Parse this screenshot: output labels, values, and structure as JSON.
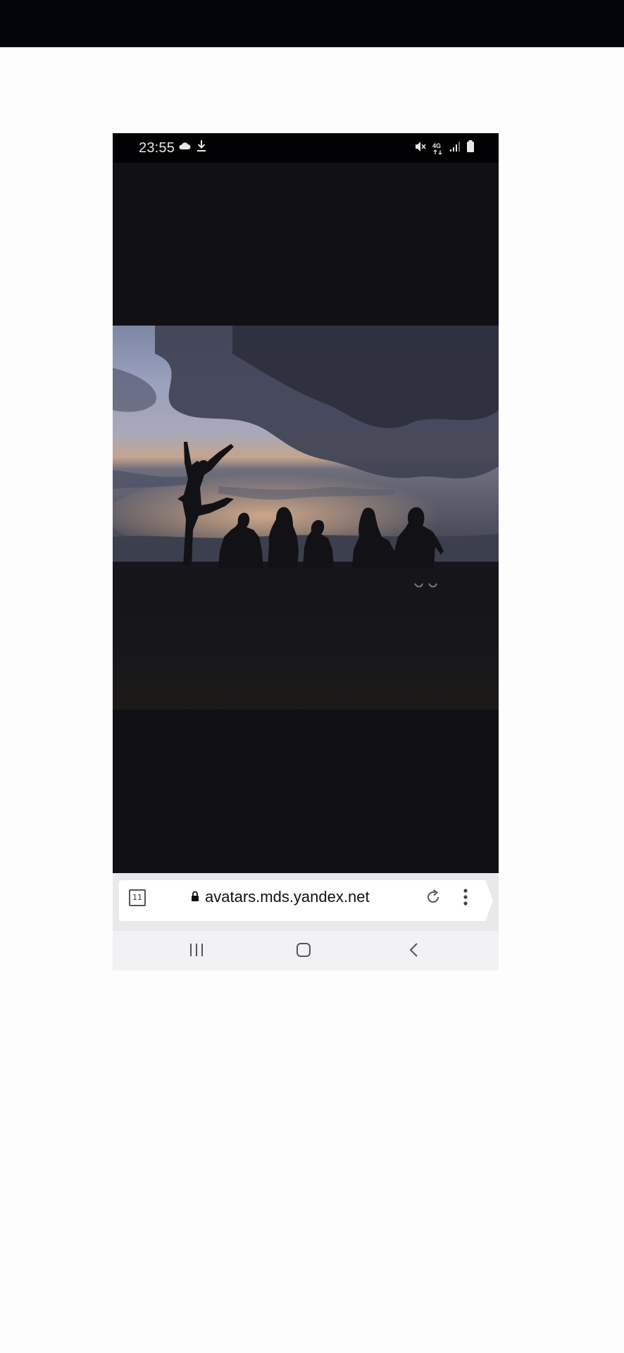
{
  "status_bar": {
    "time": "23:55",
    "network": "4G",
    "left_icons": [
      "cloud-icon",
      "download-icon"
    ],
    "right_icons": [
      "mute-icon",
      "network-4g-icon",
      "signal-icon",
      "battery-icon"
    ]
  },
  "browser": {
    "tab_count": "11",
    "url": "avatars.mds.yandex.net",
    "icons": [
      "tabs-icon",
      "lock-icon",
      "reload-icon",
      "menu-icon"
    ]
  },
  "nav": {
    "icons": [
      "recents-icon",
      "home-icon",
      "back-icon"
    ]
  },
  "colors": {
    "background": "#fdfdfd",
    "top_bar": "#04050a",
    "phone_background": "#111015",
    "browser_bar": "#e9e9ec",
    "nav_bar": "#f2f1f4"
  }
}
